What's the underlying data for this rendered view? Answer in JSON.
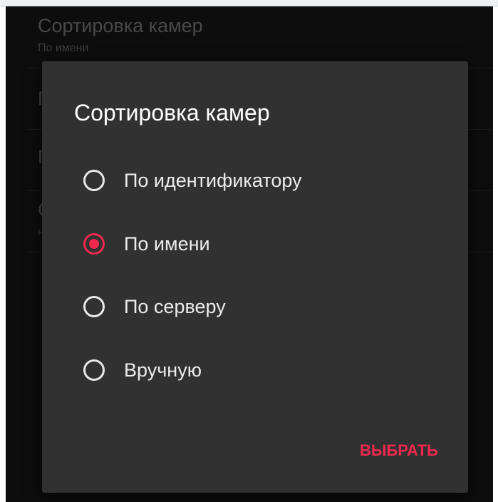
{
  "background_list": {
    "items": [
      {
        "title": "Сортировка камер",
        "subtitle": "По имени"
      },
      {
        "title": "П",
        "subtitle": ""
      },
      {
        "title": "П",
        "subtitle": ""
      },
      {
        "title": "С",
        "subtitle": "н"
      }
    ]
  },
  "dialog": {
    "title": "Сортировка камер",
    "options": [
      {
        "label": "По идентификатору",
        "selected": false
      },
      {
        "label": "По имени",
        "selected": true
      },
      {
        "label": "По серверу",
        "selected": false
      },
      {
        "label": "Вручную",
        "selected": false
      }
    ],
    "action_label": "ВЫБРАТЬ"
  },
  "colors": {
    "accent": "#f0284e",
    "dialog_bg": "#313131",
    "screen_bg": "#141414"
  }
}
